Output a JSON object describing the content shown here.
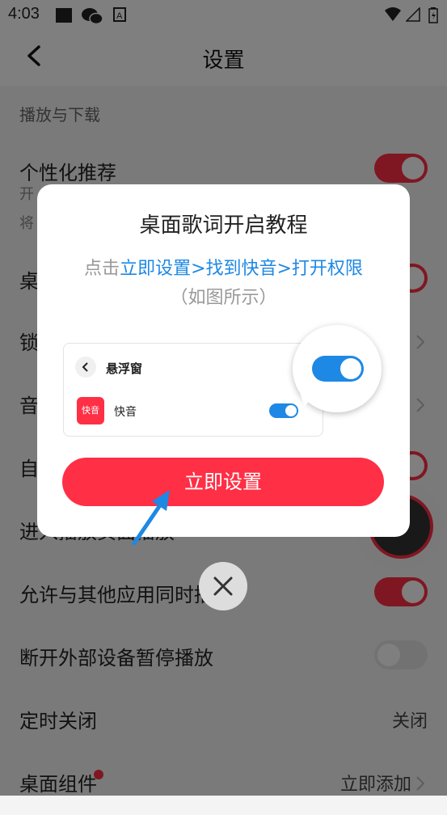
{
  "status_bar": {
    "time": "4:03"
  },
  "header": {
    "title": "设置"
  },
  "section": {
    "title": "播放与下载"
  },
  "settings": {
    "personalized": {
      "label": "个性化推荐",
      "sub1": "开",
      "sub2": "将"
    },
    "desktop_lyrics": {
      "label": "桌"
    },
    "lockscreen": {
      "label": "锁"
    },
    "audio_quality": {
      "label": "音"
    },
    "auto": {
      "label": "自"
    },
    "enter_player": {
      "label": "进入播放页面播放"
    },
    "allow_others": {
      "label": "允许与其他应用同时播放"
    },
    "external_pause": {
      "label": "断开外部设备暂停播放"
    },
    "timer": {
      "label": "定时关闭",
      "value": "关闭"
    },
    "widget": {
      "label": "桌面组件",
      "value": "立即添加"
    }
  },
  "modal": {
    "title": "桌面歌词开启教程",
    "desc_prefix": "点击",
    "desc_link": "立即设置>找到快音>打开权限",
    "note": "（如图所示）",
    "preview": {
      "title": "悬浮窗",
      "app_name": "快音",
      "app_icon_text": "快音"
    },
    "button": "立即设置"
  },
  "colors": {
    "accent": "#ff2f45",
    "link_blue": "#1e88e5"
  }
}
